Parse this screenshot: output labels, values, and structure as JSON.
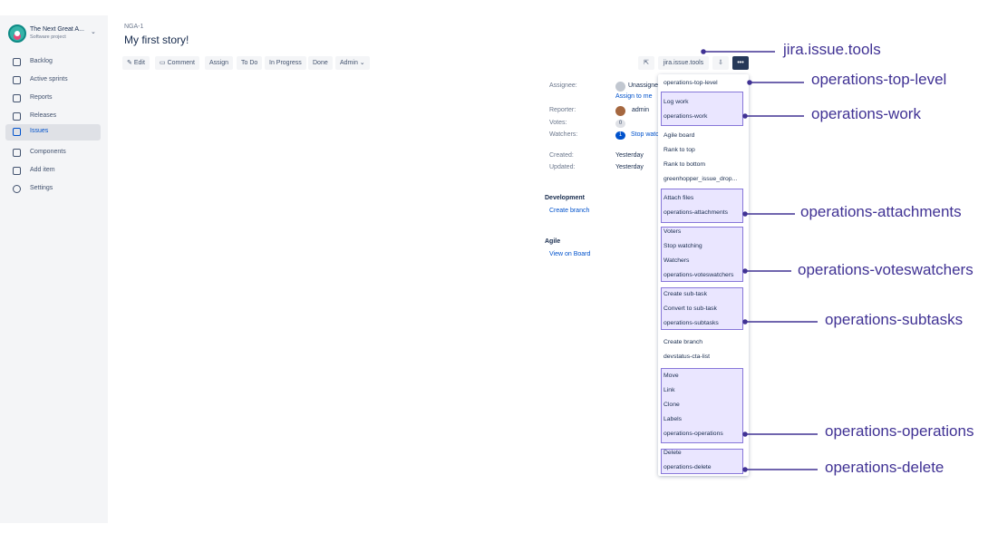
{
  "project": {
    "name": "The Next Great A...",
    "type": "Software project"
  },
  "sidebar": {
    "items": [
      {
        "label": "Backlog",
        "icon": "backlog-icon",
        "active": false
      },
      {
        "label": "Active sprints",
        "icon": "board-icon",
        "active": false
      },
      {
        "label": "Reports",
        "icon": "chart-icon",
        "active": false
      },
      {
        "label": "Releases",
        "icon": "ship-icon",
        "active": false
      },
      {
        "label": "Issues",
        "icon": "issues-icon",
        "active": true
      },
      {
        "label": "Components",
        "icon": "component-icon",
        "active": false
      },
      {
        "label": "Add item",
        "icon": "add-icon",
        "active": false
      },
      {
        "label": "Settings",
        "icon": "gear-icon",
        "active": false
      }
    ]
  },
  "issue": {
    "key": "NGA-1",
    "title": "My first story!"
  },
  "toolbar": {
    "edit": "Edit",
    "comment": "Comment",
    "assign": "Assign",
    "todo": "To Do",
    "in_progress": "In Progress",
    "done": "Done",
    "admin": "Admin",
    "tools_label": "jira.issue.tools",
    "more": "•••"
  },
  "details": {
    "assignee_label": "Assignee:",
    "assignee_value": "Unassigne",
    "assign_to_me": "Assign to me",
    "reporter_label": "Reporter:",
    "reporter_value": "admin",
    "votes_label": "Votes:",
    "votes_value": "0",
    "watchers_label": "Watchers:",
    "watchers_count": "1",
    "watchers_action": "Stop watc",
    "created_label": "Created:",
    "created_value": "Yesterday",
    "updated_label": "Updated:",
    "updated_value": "Yesterday"
  },
  "development": {
    "heading": "Development",
    "create_branch": "Create branch"
  },
  "agile": {
    "heading": "Agile",
    "view_on_board": "View on Board"
  },
  "menu": {
    "top_level": "operations-top-level",
    "log_work": "Log work",
    "op_work": "operations-work",
    "agile_board": "Agile board",
    "rank_top": "Rank to top",
    "rank_bottom": "Rank to bottom",
    "greenhopper": "greenhopper_issue_drop...",
    "attach_files": "Attach files",
    "op_attachments": "operations-attachments",
    "voters": "Voters",
    "stop_watching": "Stop watching",
    "watchers": "Watchers",
    "op_voteswatchers": "operations-voteswatchers",
    "create_subtask": "Create sub-task",
    "convert_subtask": "Convert to sub-task",
    "op_subtasks": "operations-subtasks",
    "create_branch": "Create branch",
    "devstatus": "devstatus-cta-list",
    "move": "Move",
    "link": "Link",
    "clone": "Clone",
    "labels": "Labels",
    "op_operations": "operations-operations",
    "delete": "Delete",
    "op_delete": "operations-delete"
  },
  "annotations": {
    "tools": "jira.issue.tools",
    "top_level": "operations-top-level",
    "work": "operations-work",
    "attachments": "operations-attachments",
    "voteswatchers": "operations-voteswatchers",
    "subtasks": "operations-subtasks",
    "operations": "operations-operations",
    "delete": "operations-delete"
  },
  "colors": {
    "accent": "#0052cc",
    "annotation": "#403294",
    "group_fill": "#eae6ff",
    "group_border": "#8777d9",
    "sidebar_bg": "#f4f5f7"
  }
}
